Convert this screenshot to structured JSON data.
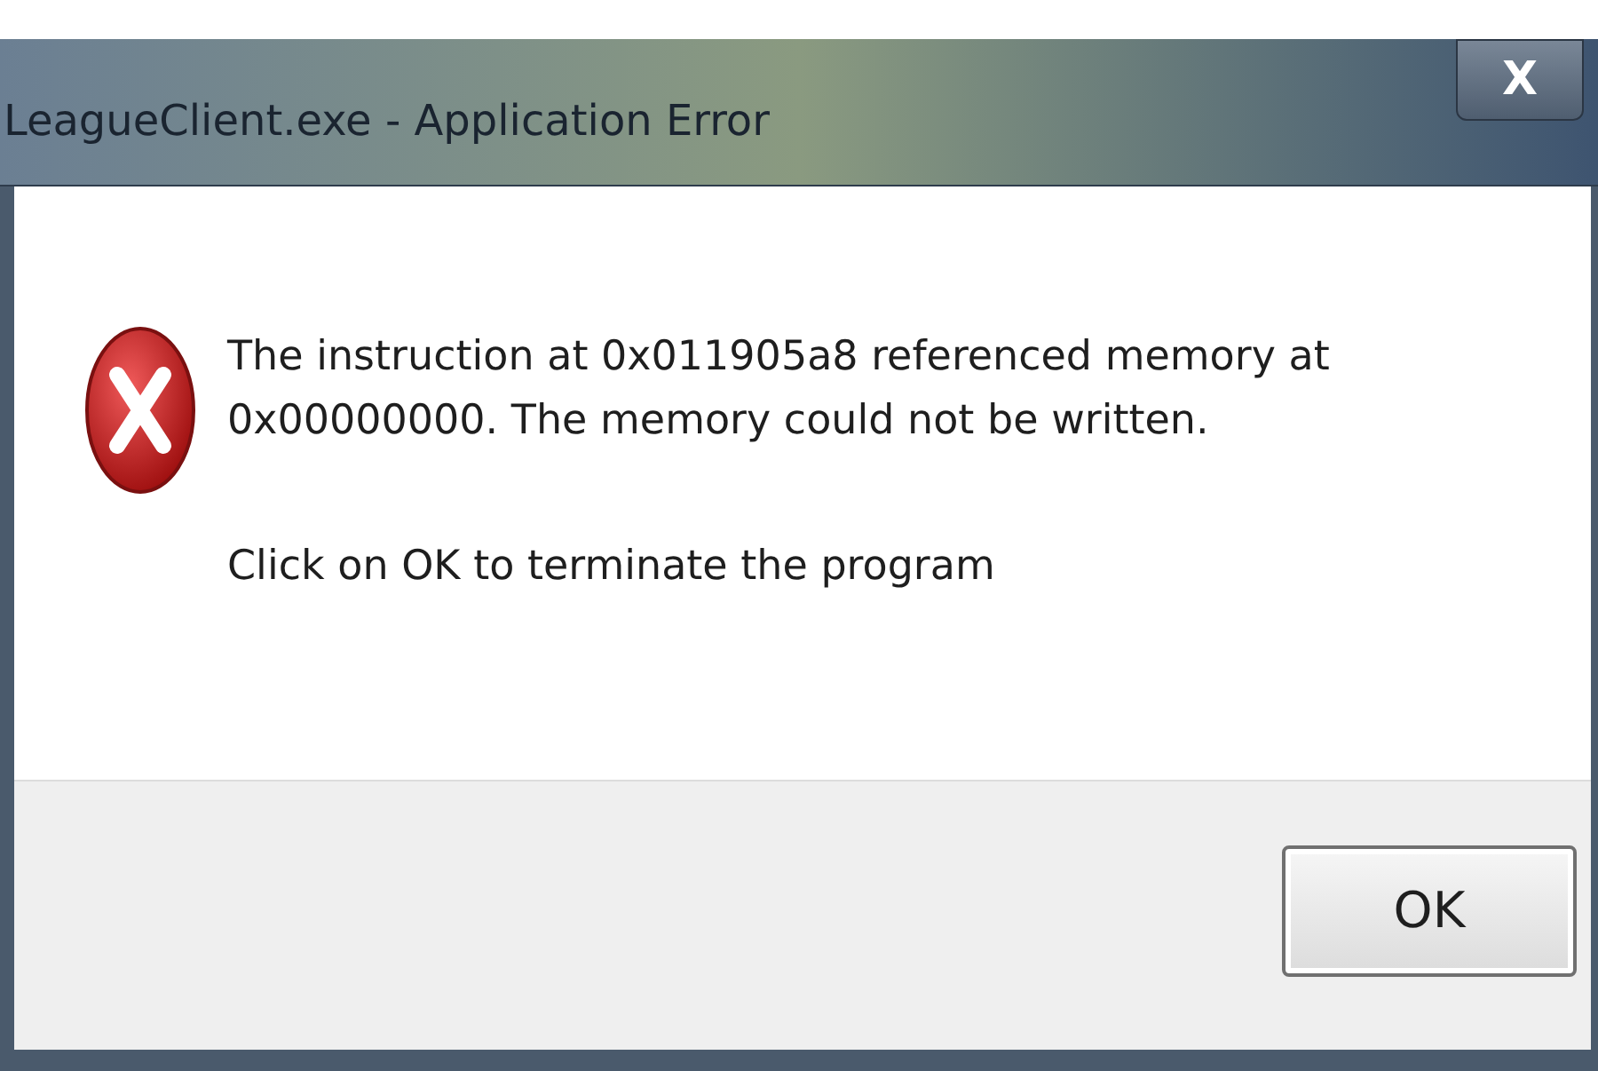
{
  "window": {
    "title": "LeagueClient.exe - Application Error",
    "close": "X"
  },
  "message": {
    "lines": [
      "The instruction at 0x011905a8 referenced memory at 0x00000000. The memory could not be written.",
      "Click on OK to terminate the program"
    ]
  },
  "buttons": [
    {
      "label": "OK"
    }
  ]
}
